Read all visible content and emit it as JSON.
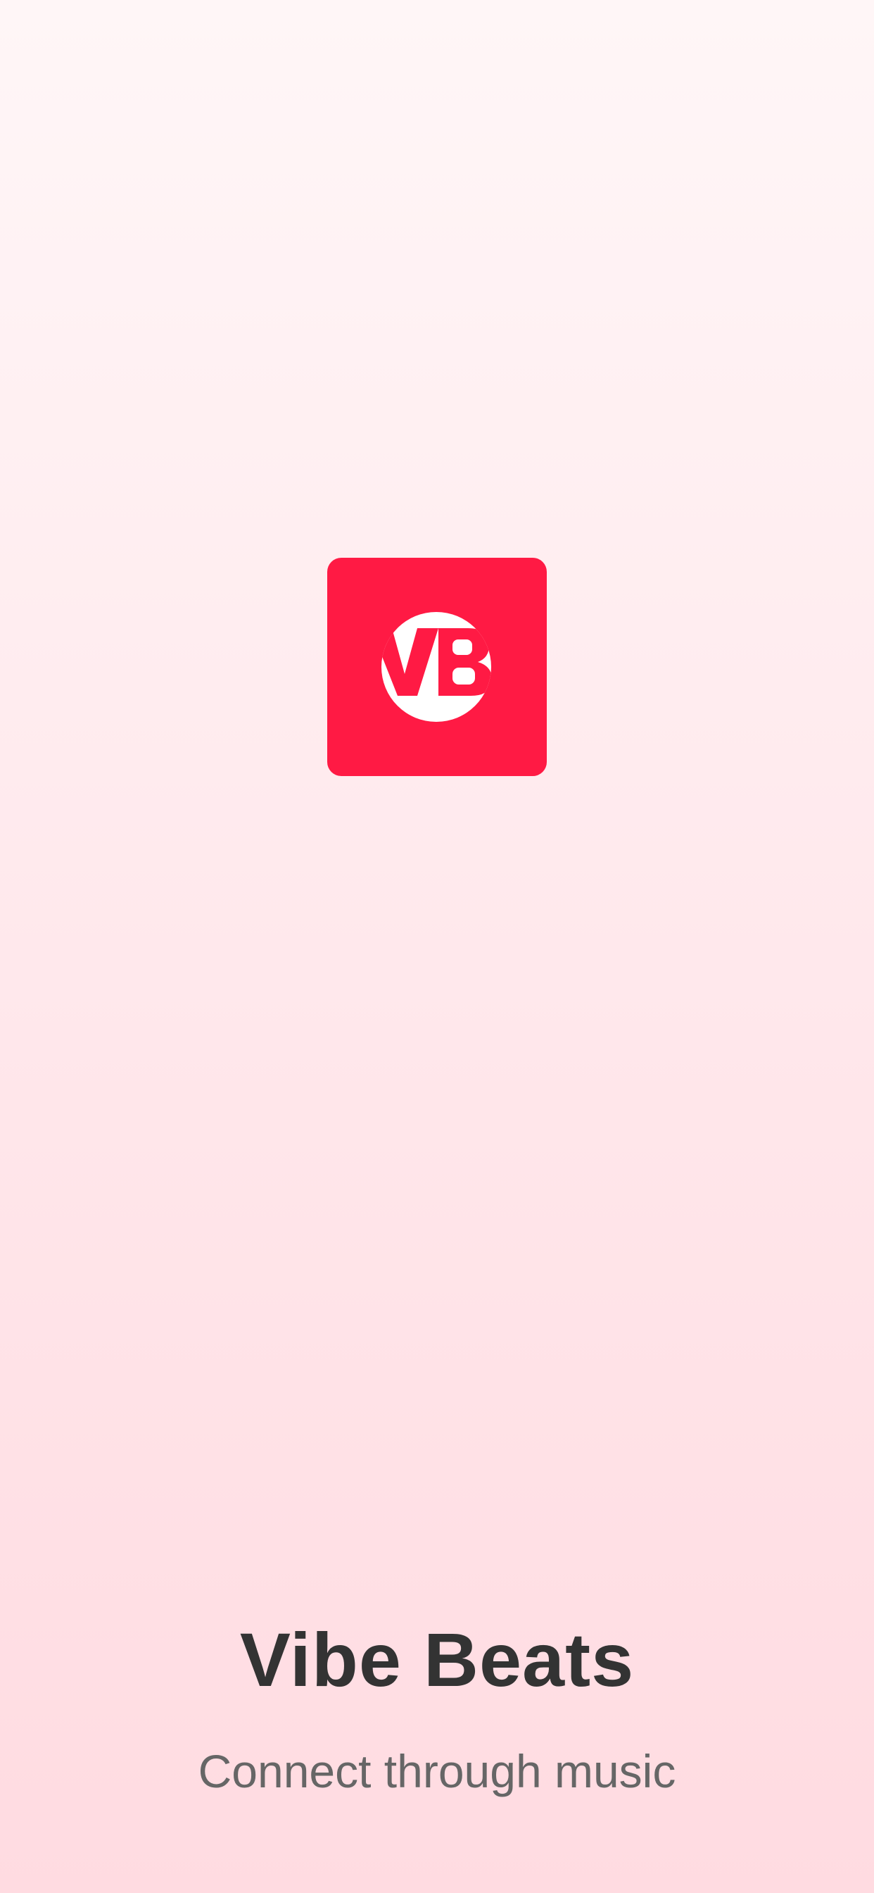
{
  "splash": {
    "logo": {
      "initials": "VB",
      "icon": "vb-monogram-icon",
      "tile_color": "#ff1a44",
      "mark_color": "#ffffff"
    },
    "title": "Vibe Beats",
    "tagline": "Connect through music"
  }
}
